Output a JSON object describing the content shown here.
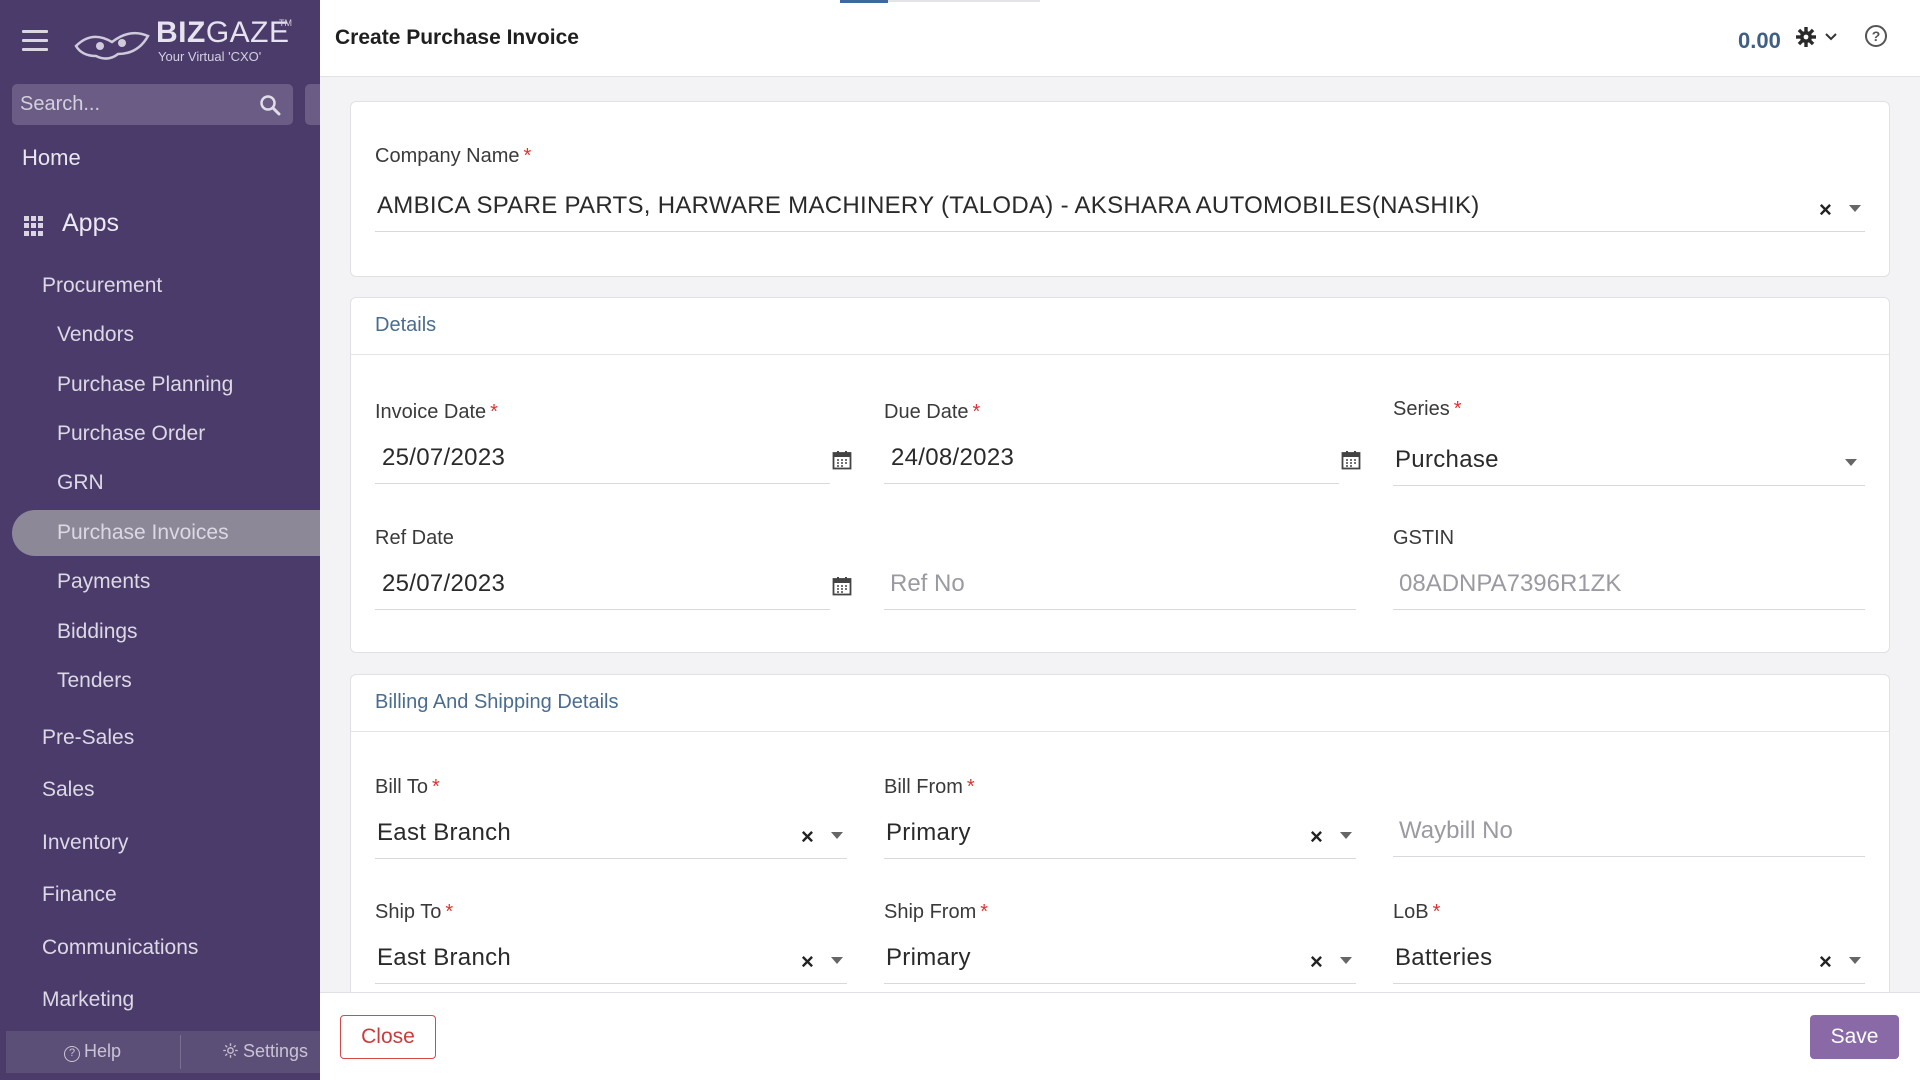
{
  "sidebar": {
    "brand": {
      "name_bold": "BIZ",
      "name_light": "GAZE",
      "trademark": "TM",
      "tagline": "Your Virtual 'CXO'"
    },
    "search_placeholder": "Search...",
    "home": "Home",
    "apps": "Apps",
    "procurement": "Procurement",
    "procurement_items": [
      "Vendors",
      "Purchase Planning",
      "Purchase Order",
      "GRN",
      "Purchase Invoices",
      "Payments",
      "Biddings",
      "Tenders"
    ],
    "active_item": "Purchase Invoices",
    "sections": [
      "Pre-Sales",
      "Sales",
      "Inventory",
      "Finance",
      "Communications",
      "Marketing"
    ],
    "help": "Help",
    "settings": "Settings"
  },
  "header": {
    "title": "Create Purchase Invoice",
    "total": "0.00"
  },
  "company": {
    "label": "Company Name",
    "value": "AMBICA SPARE PARTS, HARWARE MACHINERY (TALODA) - AKSHARA AUTOMOBILES(NASHIK)"
  },
  "details": {
    "title": "Details",
    "invoice_date": {
      "label": "Invoice Date",
      "value": "25/07/2023"
    },
    "due_date": {
      "label": "Due Date",
      "value": "24/08/2023"
    },
    "series": {
      "label": "Series",
      "value": "Purchase"
    },
    "ref_date": {
      "label": "Ref Date",
      "value": "25/07/2023"
    },
    "ref_no": {
      "placeholder": "Ref No"
    },
    "gstin": {
      "label": "GSTIN",
      "placeholder": "08ADNPA7396R1ZK"
    }
  },
  "billing": {
    "title": "Billing And Shipping Details",
    "bill_to": {
      "label": "Bill To",
      "value": "East Branch"
    },
    "bill_from": {
      "label": "Bill From",
      "value": "Primary"
    },
    "waybill": {
      "placeholder": "Waybill No"
    },
    "ship_to": {
      "label": "Ship To",
      "value": "East Branch"
    },
    "ship_from": {
      "label": "Ship From",
      "value": "Primary"
    },
    "lob": {
      "label": "LoB",
      "value": "Batteries"
    }
  },
  "footer": {
    "close": "Close",
    "save": "Save"
  },
  "colors": {
    "sidebar_bg": "#4b3b6b",
    "accent": "#8a6aa6",
    "link_blue": "#4a6d8f",
    "danger": "#d44a4a"
  }
}
